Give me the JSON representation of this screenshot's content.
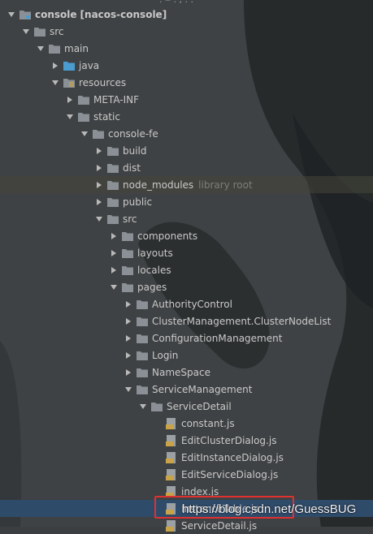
{
  "top_fragment": ". ‒ . , . .",
  "tree": [
    {
      "label": "console",
      "suffix": "[nacos-console]",
      "type": "module",
      "expanded": true,
      "level": 0
    },
    {
      "label": "src",
      "type": "folder",
      "expanded": true,
      "level": 1
    },
    {
      "label": "main",
      "type": "folder",
      "expanded": true,
      "level": 2
    },
    {
      "label": "java",
      "type": "folder-java",
      "expanded": false,
      "level": 3
    },
    {
      "label": "resources",
      "type": "folder-resources",
      "expanded": true,
      "level": 3
    },
    {
      "label": "META-INF",
      "type": "folder",
      "expanded": false,
      "level": 4
    },
    {
      "label": "static",
      "type": "folder",
      "expanded": true,
      "level": 4
    },
    {
      "label": "console-fe",
      "type": "folder",
      "expanded": true,
      "level": 5
    },
    {
      "label": "build",
      "type": "folder",
      "expanded": false,
      "level": 6
    },
    {
      "label": "dist",
      "type": "folder",
      "expanded": false,
      "level": 6
    },
    {
      "label": "node_modules",
      "type": "folder",
      "expanded": false,
      "level": 6,
      "note": "library root",
      "highlight": true
    },
    {
      "label": "public",
      "type": "folder",
      "expanded": false,
      "level": 6
    },
    {
      "label": "src",
      "type": "folder",
      "expanded": true,
      "level": 6
    },
    {
      "label": "components",
      "type": "folder",
      "expanded": false,
      "level": 7
    },
    {
      "label": "layouts",
      "type": "folder",
      "expanded": false,
      "level": 7
    },
    {
      "label": "locales",
      "type": "folder",
      "expanded": false,
      "level": 7
    },
    {
      "label": "pages",
      "type": "folder",
      "expanded": true,
      "level": 7
    },
    {
      "label": "AuthorityControl",
      "type": "folder",
      "expanded": false,
      "level": 8
    },
    {
      "label": "ClusterManagement.ClusterNodeList",
      "type": "folder",
      "expanded": false,
      "level": 8
    },
    {
      "label": "ConfigurationManagement",
      "type": "folder",
      "expanded": false,
      "level": 8
    },
    {
      "label": "Login",
      "type": "folder",
      "expanded": false,
      "level": 8
    },
    {
      "label": "NameSpace",
      "type": "folder",
      "expanded": false,
      "level": 8
    },
    {
      "label": "ServiceManagement",
      "type": "folder",
      "expanded": true,
      "level": 8
    },
    {
      "label": "ServiceDetail",
      "type": "folder",
      "expanded": true,
      "level": 9
    },
    {
      "label": "constant.js",
      "type": "js",
      "level": 10
    },
    {
      "label": "EditClusterDialog.js",
      "type": "js",
      "level": 10
    },
    {
      "label": "EditInstanceDialog.js",
      "type": "js",
      "level": 10
    },
    {
      "label": "EditServiceDialog.js",
      "type": "js",
      "level": 10
    },
    {
      "label": "index.js",
      "type": "js",
      "level": 10
    },
    {
      "label": "InstanceTable.js",
      "type": "js",
      "level": 10,
      "selected": true
    },
    {
      "label": "ServiceDetail.js",
      "type": "js",
      "level": 10
    }
  ],
  "watermark": "https://blog.csdn.net/GuessBUG",
  "colors": {
    "background": "#3c3f41",
    "folder": "#8a9096",
    "java_folder": "#4a9ccf",
    "resources_stripe": "#c9a347",
    "arrow": "#b8b8b8",
    "selection": "#2f4b6a",
    "red_box": "#e03131",
    "js_badge": "#c9a347"
  }
}
